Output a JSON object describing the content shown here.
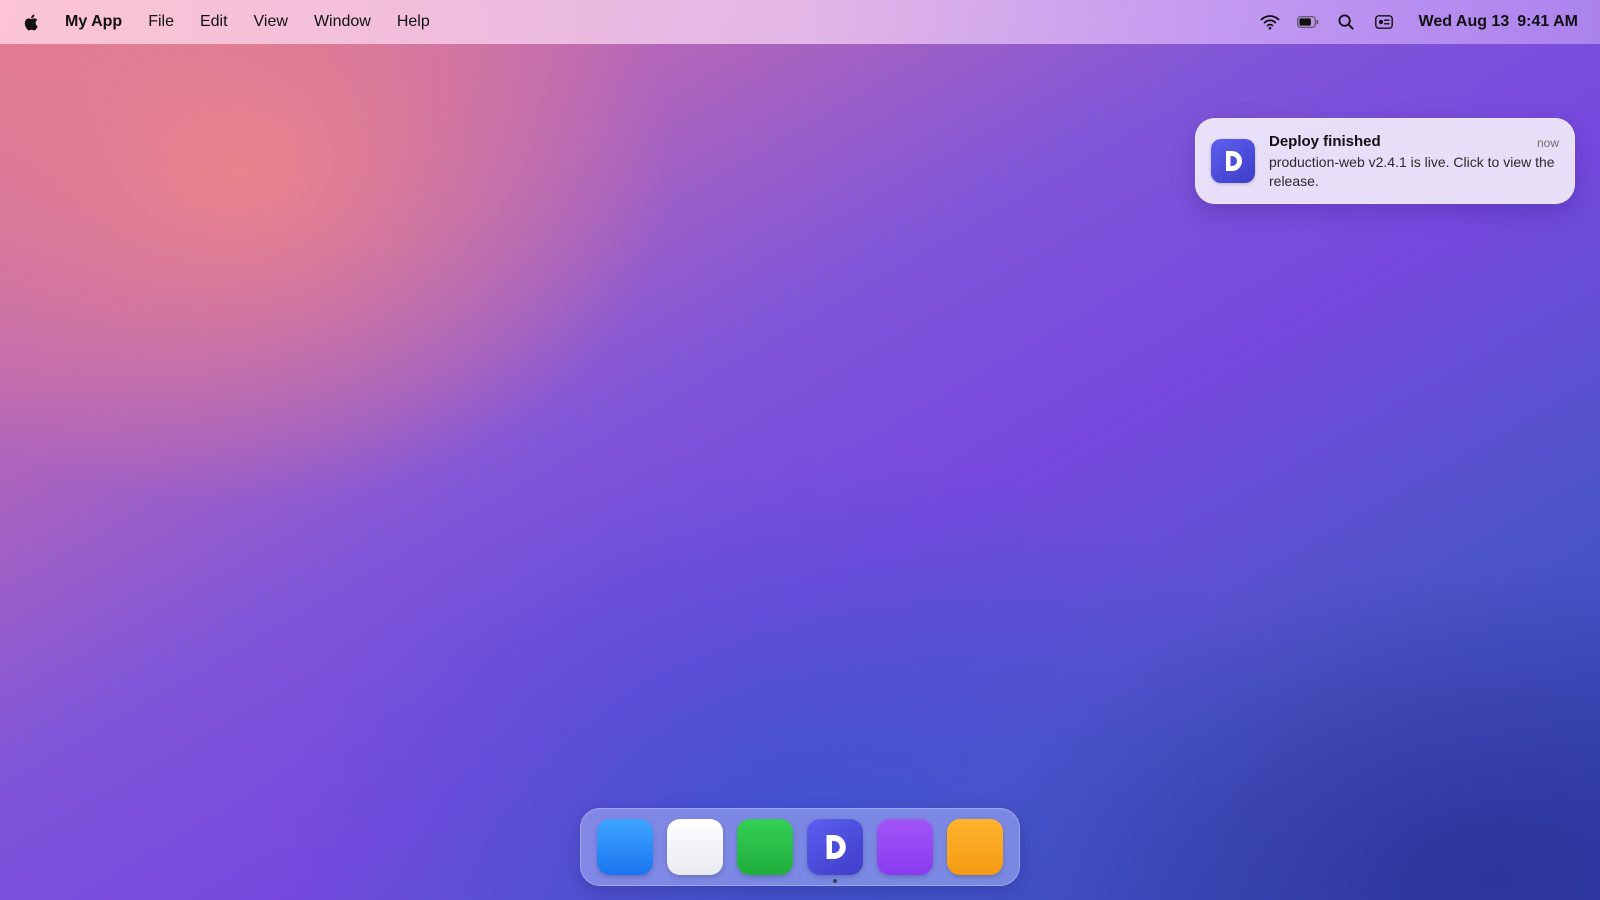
{
  "menubar": {
    "apple_icon": "apple-icon",
    "app_name": "My App",
    "items": [
      "File",
      "Edit",
      "View",
      "Window",
      "Help"
    ],
    "status_icons": [
      "wifi-icon",
      "battery-icon",
      "search-icon",
      "control-center-icon"
    ],
    "date": "Wed Aug 13",
    "time": "9:41 AM"
  },
  "notification": {
    "app_icon": "app-logo-icon",
    "title": "Deploy finished",
    "time": "now",
    "body": "production-web v2.4.1 is live. Click to view the release."
  },
  "dock": {
    "apps": [
      {
        "icon": "blue-app-icon",
        "color": "#1b74f0"
      },
      {
        "icon": "white-app-icon",
        "color": "#f2f2f6"
      },
      {
        "icon": "green-app-icon",
        "color": "#27bd47"
      },
      {
        "icon": "app-logo-icon",
        "color": "#4a4ae0",
        "running": true
      },
      {
        "icon": "purple-app-icon",
        "color": "#9447f4"
      },
      {
        "icon": "orange-app-icon",
        "color": "#f7a21d"
      }
    ]
  },
  "colors": {
    "accent": "#4a4ae0",
    "wallpaper_pink": "#e27b93",
    "wallpaper_purple": "#7749df",
    "wallpaper_blue": "#3345b8"
  }
}
